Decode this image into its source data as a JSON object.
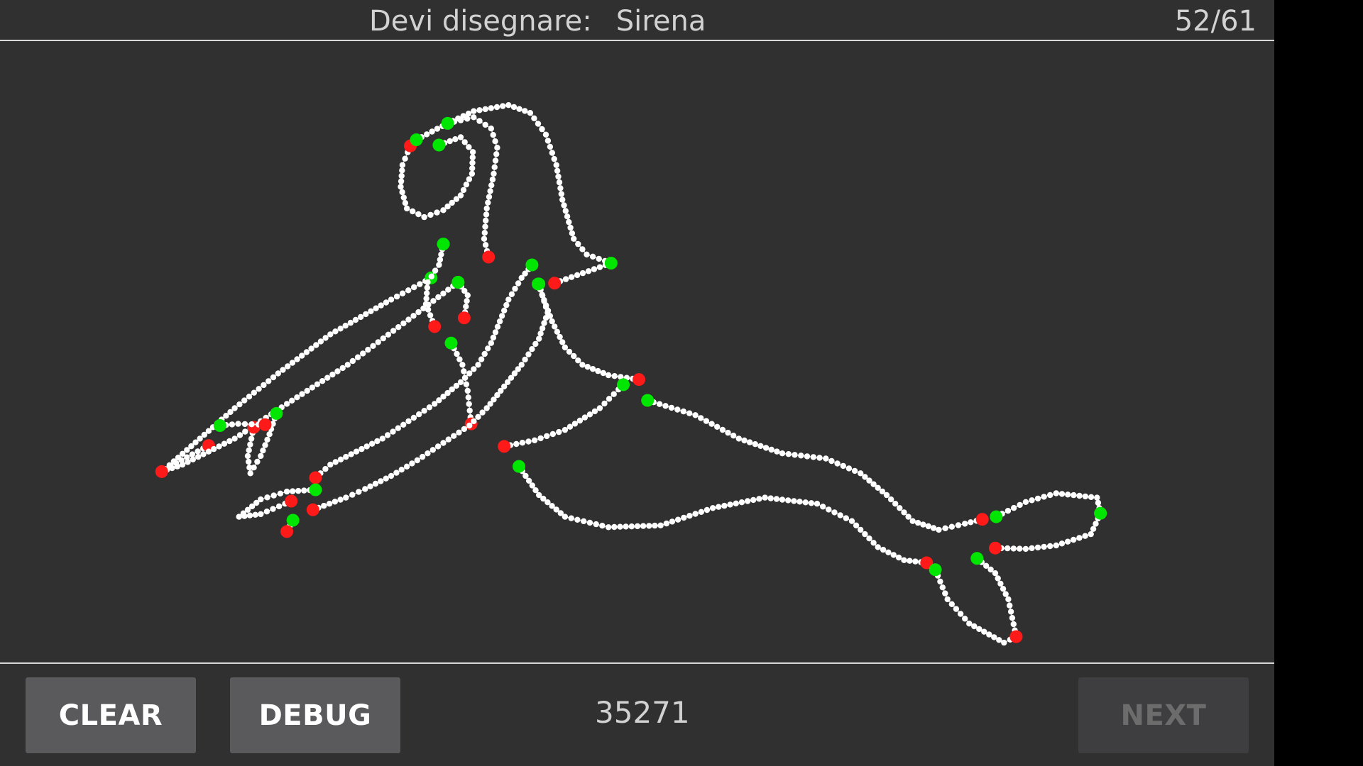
{
  "header": {
    "prompt_label": "Devi disegnare:",
    "target_word": "Sirena",
    "progress": "52/61"
  },
  "footer": {
    "clear_label": "CLEAR",
    "debug_label": "DEBUG",
    "score": "35271",
    "next_label": "NEXT",
    "next_enabled": false
  },
  "colors": {
    "background": "#303030",
    "stroke": "#ffffff",
    "stroke_start": "#00e600",
    "stroke_end": "#ff1a1a"
  }
}
